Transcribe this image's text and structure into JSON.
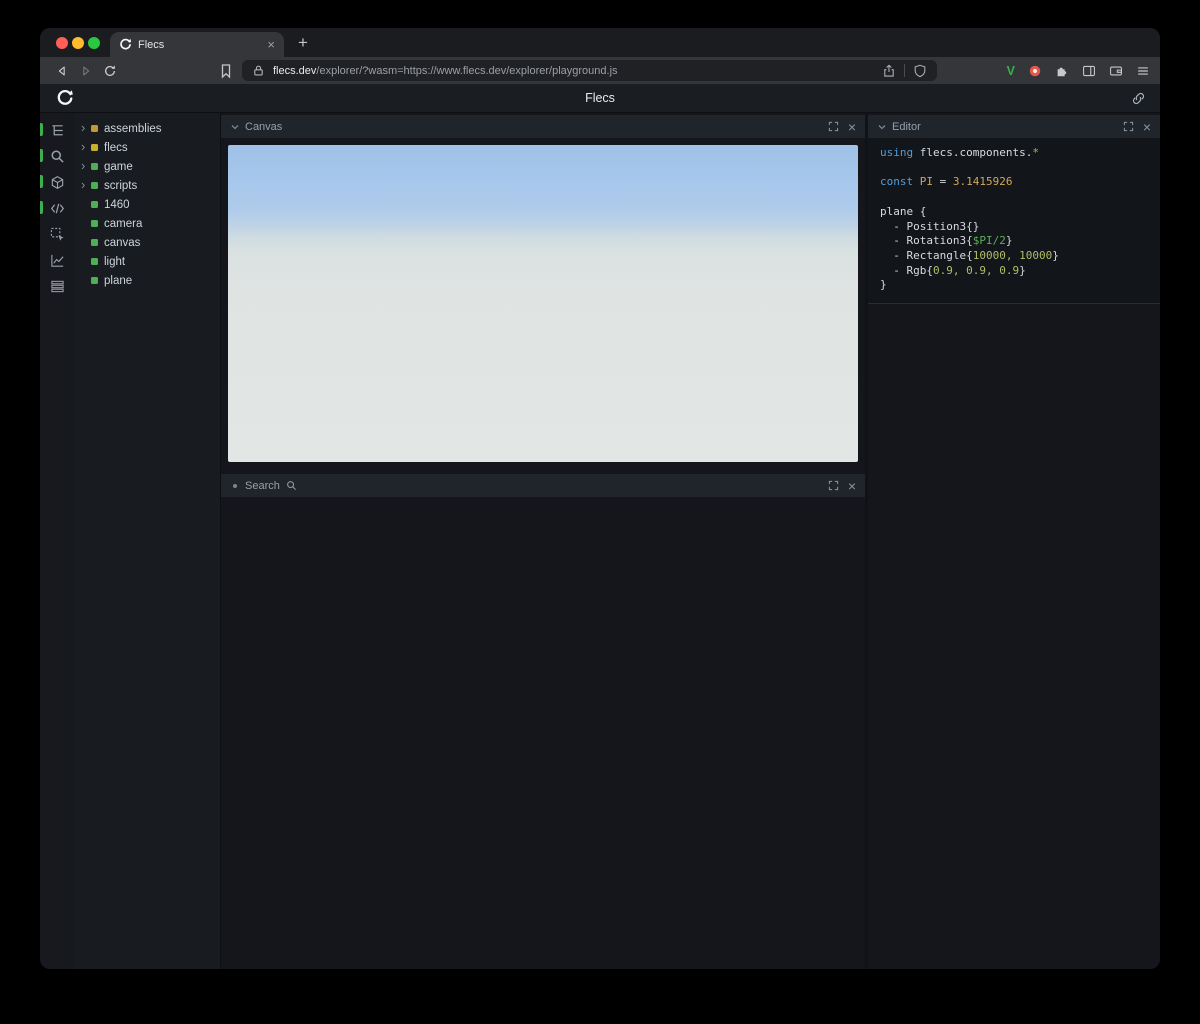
{
  "browser": {
    "tab_title": "Flecs",
    "new_tab_label": "+",
    "url_domain": "flecs.dev",
    "url_path": "/explorer/?wasm=https://www.flecs.dev/explorer/playground.js",
    "v_extension_label": "V"
  },
  "app": {
    "title": "Flecs",
    "sidebar_icons": [
      {
        "name": "tree-outliner-icon",
        "icon": "outliner",
        "active": true
      },
      {
        "name": "query-search-icon",
        "icon": "searchsm",
        "active": true
      },
      {
        "name": "canvas-cube-icon",
        "icon": "cube",
        "active": true
      },
      {
        "name": "script-code-icon",
        "icon": "code",
        "active": true
      },
      {
        "name": "inspect-select-icon",
        "icon": "select",
        "active": false
      },
      {
        "name": "stats-chart-icon",
        "icon": "chart",
        "active": false
      },
      {
        "name": "tables-rows-icon",
        "icon": "rows",
        "active": false
      }
    ],
    "tree": {
      "items": [
        {
          "label": "assemblies",
          "expandable": true,
          "color": "#c2992f"
        },
        {
          "label": "flecs",
          "expandable": true,
          "color": "#c9b02f"
        },
        {
          "label": "game",
          "expandable": true,
          "color": "#4fae57"
        },
        {
          "label": "scripts",
          "expandable": true,
          "color": "#4fae57"
        },
        {
          "label": "1460",
          "expandable": false,
          "color": "#4fae57"
        },
        {
          "label": "camera",
          "expandable": false,
          "color": "#4fae57"
        },
        {
          "label": "canvas",
          "expandable": false,
          "color": "#4fae57"
        },
        {
          "label": "light",
          "expandable": false,
          "color": "#4fae57"
        },
        {
          "label": "plane",
          "expandable": false,
          "color": "#4fae57"
        }
      ]
    },
    "canvas_panel": {
      "title": "Canvas"
    },
    "search_panel": {
      "title": "Search"
    },
    "editor_panel": {
      "title": "Editor",
      "code_lines": [
        [
          {
            "t": "using",
            "c": "kw"
          },
          {
            "t": " flecs.components.",
            "c": "pl"
          },
          {
            "t": "*",
            "c": "gold"
          }
        ],
        [],
        [
          {
            "t": "const",
            "c": "kw"
          },
          {
            "t": " ",
            "c": "pl"
          },
          {
            "t": "PI",
            "c": "gold"
          },
          {
            "t": " = ",
            "c": "pl"
          },
          {
            "t": "3.1415926",
            "c": "gold"
          }
        ],
        [],
        [
          {
            "t": "plane",
            "c": "pl"
          },
          {
            "t": " {",
            "c": "pl"
          }
        ],
        [
          {
            "t": "  - ",
            "c": "pl"
          },
          {
            "t": "Position3",
            "c": "pl"
          },
          {
            "t": "{}",
            "c": "pl"
          }
        ],
        [
          {
            "t": "  - ",
            "c": "pl"
          },
          {
            "t": "Rotation3",
            "c": "pl"
          },
          {
            "t": "{",
            "c": "pl"
          },
          {
            "t": "$PI/2",
            "c": "var"
          },
          {
            "t": "}",
            "c": "pl"
          }
        ],
        [
          {
            "t": "  - ",
            "c": "pl"
          },
          {
            "t": "Rectangle",
            "c": "pl"
          },
          {
            "t": "{",
            "c": "pl"
          },
          {
            "t": "10000, 10000",
            "c": "num"
          },
          {
            "t": "}",
            "c": "pl"
          }
        ],
        [
          {
            "t": "  - ",
            "c": "pl"
          },
          {
            "t": "Rgb",
            "c": "pl"
          },
          {
            "t": "{",
            "c": "pl"
          },
          {
            "t": "0.9, 0.9, 0.9",
            "c": "num"
          },
          {
            "t": "}",
            "c": "pl"
          }
        ],
        [
          {
            "t": "}",
            "c": "pl"
          }
        ]
      ]
    }
  },
  "colors": {
    "active_indicator": "#3fae4f",
    "module_yellow": "#c9b02f",
    "entity_green": "#4fae57",
    "sky_top": "#9fc1e7",
    "ground": "#e2e6e4"
  }
}
